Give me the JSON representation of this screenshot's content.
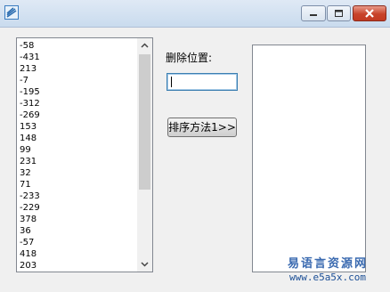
{
  "window": {
    "icon": "app-icon",
    "controls": [
      "minimize-icon",
      "maximize-icon",
      "close-icon"
    ]
  },
  "number_list": {
    "items": [
      "-58",
      "-431",
      "213",
      "-7",
      "-195",
      "-312",
      "-269",
      "153",
      "148",
      "99",
      "231",
      "32",
      "71",
      "-233",
      "-229",
      "378",
      "36",
      "-57",
      "418",
      "203"
    ]
  },
  "delete_position": {
    "label": "删除位置:",
    "value": ""
  },
  "sort_button": {
    "label": "排序方法1>>"
  },
  "result_list": {
    "items": []
  },
  "watermark": {
    "title": "易语言资源网",
    "url": "www.e5a5x.com"
  }
}
